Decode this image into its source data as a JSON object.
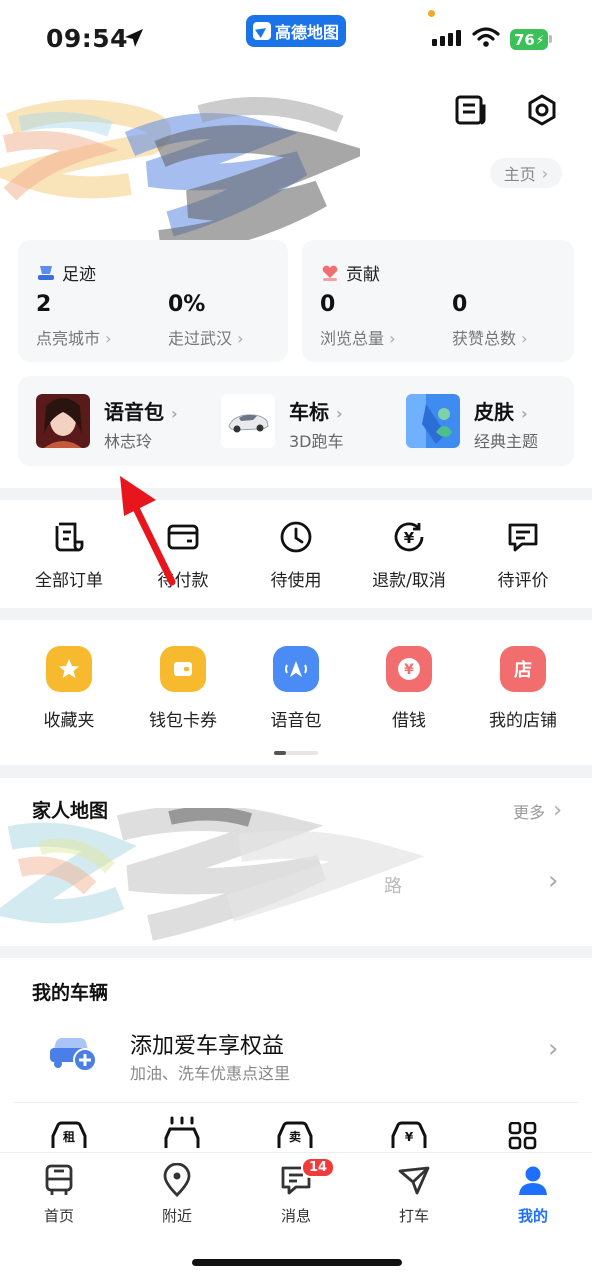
{
  "status_bar": {
    "time": "09:54",
    "app_name": "高德地图",
    "battery": "76"
  },
  "header": {
    "home_link": "主页"
  },
  "footprints": {
    "title": "足迹",
    "stats": [
      {
        "value": "2",
        "label": "点亮城市"
      },
      {
        "value": "0%",
        "label": "走过武汉"
      }
    ]
  },
  "contributions": {
    "title": "贡献",
    "stats": [
      {
        "value": "0",
        "label": "浏览总量"
      },
      {
        "value": "0",
        "label": "获赞总数"
      }
    ]
  },
  "features": [
    {
      "name": "语音包",
      "sub": "林志玲",
      "icon": "voice-pack-avatar"
    },
    {
      "name": "车标",
      "sub": "3D跑车",
      "icon": "car-image"
    },
    {
      "name": "皮肤",
      "sub": "经典主题",
      "icon": "skin-image"
    }
  ],
  "orders": [
    {
      "label": "全部订单",
      "icon": "order-list-icon"
    },
    {
      "label": "待付款",
      "icon": "wallet-icon"
    },
    {
      "label": "待使用",
      "icon": "clock-icon"
    },
    {
      "label": "退款/取消",
      "icon": "refund-icon"
    },
    {
      "label": "待评价",
      "icon": "comment-icon"
    }
  ],
  "tools": [
    {
      "label": "收藏夹",
      "icon": "star-icon",
      "color": "#f7b92e"
    },
    {
      "label": "钱包卡券",
      "icon": "wallet-icon",
      "color": "#f7b92e"
    },
    {
      "label": "语音包",
      "icon": "voice-icon",
      "color": "#4a8bf5"
    },
    {
      "label": "借钱",
      "icon": "yuan-icon",
      "color": "#f26d6d"
    },
    {
      "label": "我的店铺",
      "icon": "shop-icon",
      "color": "#f26d6d",
      "glyph": "店"
    }
  ],
  "family_map": {
    "title": "家人地图",
    "more": "更多",
    "item_partial": "路"
  },
  "vehicles": {
    "title": "我的车辆",
    "add_title": "添加爱车享权益",
    "add_sub": "加油、洗车优惠点这里",
    "services": [
      {
        "glyph": "租",
        "icon": "rent-car-icon"
      },
      {
        "glyph": "",
        "icon": "car-wash-icon"
      },
      {
        "glyph": "卖",
        "icon": "sell-car-icon"
      },
      {
        "glyph": "¥",
        "icon": "car-loan-icon"
      },
      {
        "glyph": "",
        "icon": "grid-more-icon"
      }
    ]
  },
  "tabbar": {
    "tabs": [
      {
        "label": "首页",
        "icon": "bus-icon"
      },
      {
        "label": "附近",
        "icon": "location-pin-icon"
      },
      {
        "label": "消息",
        "icon": "message-icon",
        "badge": "14"
      },
      {
        "label": "打车",
        "icon": "taxi-icon"
      },
      {
        "label": "我的",
        "icon": "person-icon",
        "active": true
      }
    ]
  },
  "colors": {
    "accent": "#1f6fff",
    "map_blue": "#1a73e8",
    "red_arrow": "#e8161c"
  }
}
